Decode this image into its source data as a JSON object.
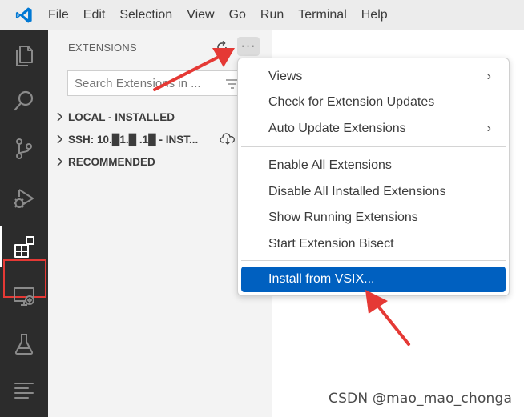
{
  "menubar": {
    "items": [
      "File",
      "Edit",
      "Selection",
      "View",
      "Go",
      "Run",
      "Terminal",
      "Help"
    ]
  },
  "activity_bar": {
    "icons": [
      "explorer-icon",
      "search-icon",
      "source-control-icon",
      "run-debug-icon",
      "extensions-icon",
      "remote-explorer-icon",
      "testing-icon",
      "outline-icon"
    ],
    "active": "extensions-icon",
    "highlight_color": "#e53935"
  },
  "sidebar": {
    "title": "EXTENSIONS",
    "more_label": "···",
    "search": {
      "placeholder": "Search Extensions in ...",
      "value": ""
    },
    "sections": [
      {
        "label": "LOCAL - INSTALLED"
      },
      {
        "label": "SSH: 10.█1.█ .1█ - INST..."
      },
      {
        "label": "RECOMMENDED"
      }
    ]
  },
  "context_menu": {
    "items": [
      {
        "label": "Views",
        "submenu": "›"
      },
      {
        "label": "Check for Extension Updates"
      },
      {
        "label": "Auto Update Extensions",
        "submenu": "›"
      },
      {
        "label": "Enable All Extensions"
      },
      {
        "label": "Disable All Installed Extensions"
      },
      {
        "label": "Show Running Extensions"
      },
      {
        "label": "Start Extension Bisect"
      },
      {
        "label": "Install from VSIX..."
      }
    ],
    "selected": "Install from VSIX...",
    "selected_color": "#0060c0"
  },
  "annotation_color": "#e53935",
  "watermark": "CSDN @mao_mao_chonga"
}
